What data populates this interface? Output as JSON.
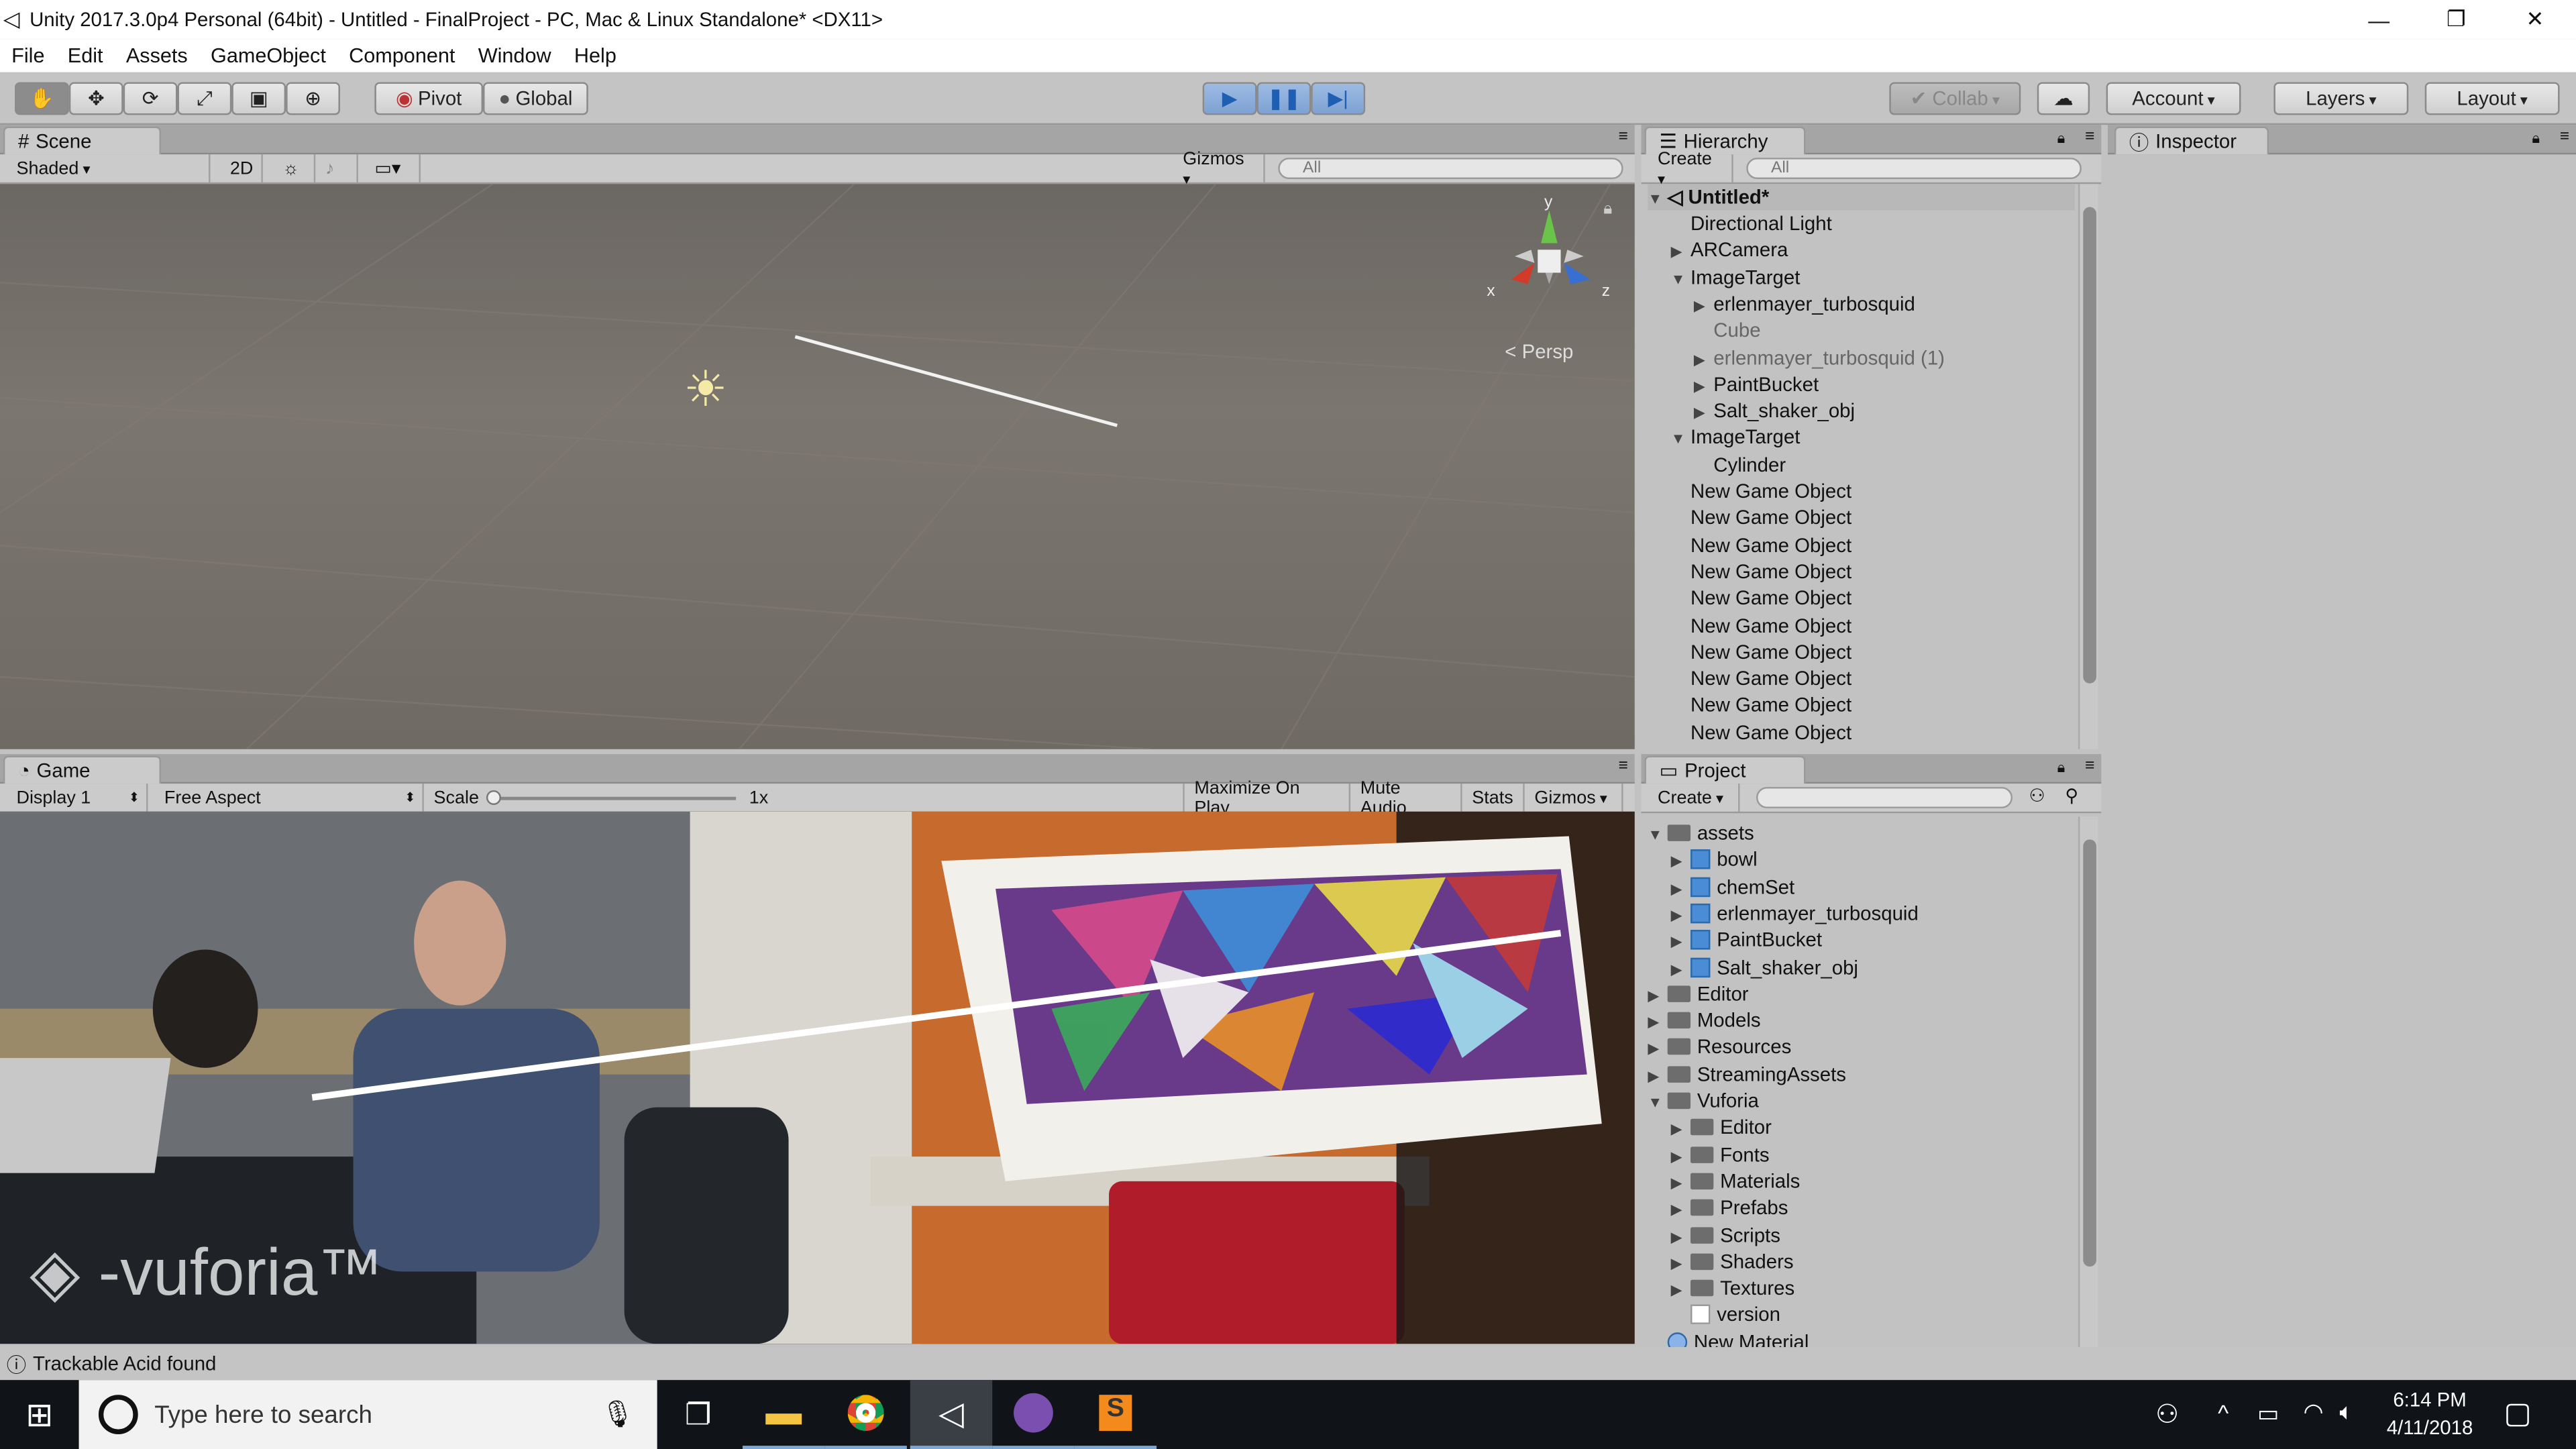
{
  "window": {
    "title": "Unity 2017.3.0p4 Personal (64bit) - Untitled - FinalProject - PC, Mac & Linux Standalone* <DX11>"
  },
  "menu": [
    "File",
    "Edit",
    "Assets",
    "GameObject",
    "Component",
    "Window",
    "Help"
  ],
  "toolbar": {
    "pivot": "Pivot",
    "global": "Global",
    "collab": "Collab",
    "account": "Account",
    "layers": "Layers",
    "layout": "Layout"
  },
  "scene": {
    "tab": "Scene",
    "shading": "Shaded",
    "twod": "2D",
    "gizmos": "Gizmos",
    "search_placeholder": "All",
    "persp": "Persp",
    "axis_x": "x",
    "axis_y": "y",
    "axis_z": "z"
  },
  "hierarchy": {
    "tab": "Hierarchy",
    "create": "Create",
    "search_placeholder": "All",
    "root": "Untitled*",
    "items": [
      {
        "label": "Directional Light",
        "indent": 1,
        "arrow": "",
        "dim": false
      },
      {
        "label": "ARCamera",
        "indent": 1,
        "arrow": "▶",
        "dim": false
      },
      {
        "label": "ImageTarget",
        "indent": 1,
        "arrow": "▼",
        "dim": false
      },
      {
        "label": "erlenmayer_turbosquid",
        "indent": 2,
        "arrow": "▶",
        "dim": false
      },
      {
        "label": "Cube",
        "indent": 2,
        "arrow": "",
        "dim": true
      },
      {
        "label": "erlenmayer_turbosquid (1)",
        "indent": 2,
        "arrow": "▶",
        "dim": true
      },
      {
        "label": "PaintBucket",
        "indent": 2,
        "arrow": "▶",
        "dim": false
      },
      {
        "label": "Salt_shaker_obj",
        "indent": 2,
        "arrow": "▶",
        "dim": false
      },
      {
        "label": "ImageTarget",
        "indent": 1,
        "arrow": "▼",
        "dim": false
      },
      {
        "label": "Cylinder",
        "indent": 2,
        "arrow": "",
        "dim": false
      },
      {
        "label": "New Game Object",
        "indent": 1,
        "arrow": "",
        "dim": false
      },
      {
        "label": "New Game Object",
        "indent": 1,
        "arrow": "",
        "dim": false
      },
      {
        "label": "New Game Object",
        "indent": 1,
        "arrow": "",
        "dim": false
      },
      {
        "label": "New Game Object",
        "indent": 1,
        "arrow": "",
        "dim": false
      },
      {
        "label": "New Game Object",
        "indent": 1,
        "arrow": "",
        "dim": false
      },
      {
        "label": "New Game Object",
        "indent": 1,
        "arrow": "",
        "dim": false
      },
      {
        "label": "New Game Object",
        "indent": 1,
        "arrow": "",
        "dim": false
      },
      {
        "label": "New Game Object",
        "indent": 1,
        "arrow": "",
        "dim": false
      },
      {
        "label": "New Game Object",
        "indent": 1,
        "arrow": "",
        "dim": false
      },
      {
        "label": "New Game Object",
        "indent": 1,
        "arrow": "",
        "dim": false
      }
    ]
  },
  "inspector": {
    "tab": "Inspector"
  },
  "game": {
    "tab": "Game",
    "display": "Display 1",
    "aspect": "Free Aspect",
    "scale_label": "Scale",
    "scale_value": "1x",
    "maximize": "Maximize On Play",
    "mute": "Mute Audio",
    "stats": "Stats",
    "gizmos": "Gizmos",
    "watermark": "vuforia"
  },
  "project": {
    "tab": "Project",
    "create": "Create",
    "items": [
      {
        "label": "assets",
        "indent": 0,
        "arrow": "▼",
        "icon": "folder"
      },
      {
        "label": "bowl",
        "indent": 1,
        "arrow": "▶",
        "icon": "cube"
      },
      {
        "label": "chemSet",
        "indent": 1,
        "arrow": "▶",
        "icon": "cube"
      },
      {
        "label": "erlenmayer_turbosquid",
        "indent": 1,
        "arrow": "▶",
        "icon": "cube"
      },
      {
        "label": "PaintBucket",
        "indent": 1,
        "arrow": "▶",
        "icon": "cube"
      },
      {
        "label": "Salt_shaker_obj",
        "indent": 1,
        "arrow": "▶",
        "icon": "cube"
      },
      {
        "label": "Editor",
        "indent": 0,
        "arrow": "▶",
        "icon": "folder"
      },
      {
        "label": "Models",
        "indent": 0,
        "arrow": "▶",
        "icon": "folder"
      },
      {
        "label": "Resources",
        "indent": 0,
        "arrow": "▶",
        "icon": "folder"
      },
      {
        "label": "StreamingAssets",
        "indent": 0,
        "arrow": "▶",
        "icon": "folder"
      },
      {
        "label": "Vuforia",
        "indent": 0,
        "arrow": "▼",
        "icon": "folder"
      },
      {
        "label": "Editor",
        "indent": 1,
        "arrow": "▶",
        "icon": "folder"
      },
      {
        "label": "Fonts",
        "indent": 1,
        "arrow": "▶",
        "icon": "folder"
      },
      {
        "label": "Materials",
        "indent": 1,
        "arrow": "▶",
        "icon": "folder"
      },
      {
        "label": "Prefabs",
        "indent": 1,
        "arrow": "▶",
        "icon": "folder"
      },
      {
        "label": "Scripts",
        "indent": 1,
        "arrow": "▶",
        "icon": "folder"
      },
      {
        "label": "Shaders",
        "indent": 1,
        "arrow": "▶",
        "icon": "folder"
      },
      {
        "label": "Textures",
        "indent": 1,
        "arrow": "▶",
        "icon": "folder"
      },
      {
        "label": "version",
        "indent": 1,
        "arrow": "",
        "icon": "file"
      },
      {
        "label": "New Material",
        "indent": 0,
        "arrow": "",
        "icon": "sphere"
      }
    ]
  },
  "status": {
    "message": "Trackable Acid found"
  },
  "taskbar": {
    "search_placeholder": "Type here to search",
    "time": "6:14 PM",
    "date": "4/11/2018"
  }
}
